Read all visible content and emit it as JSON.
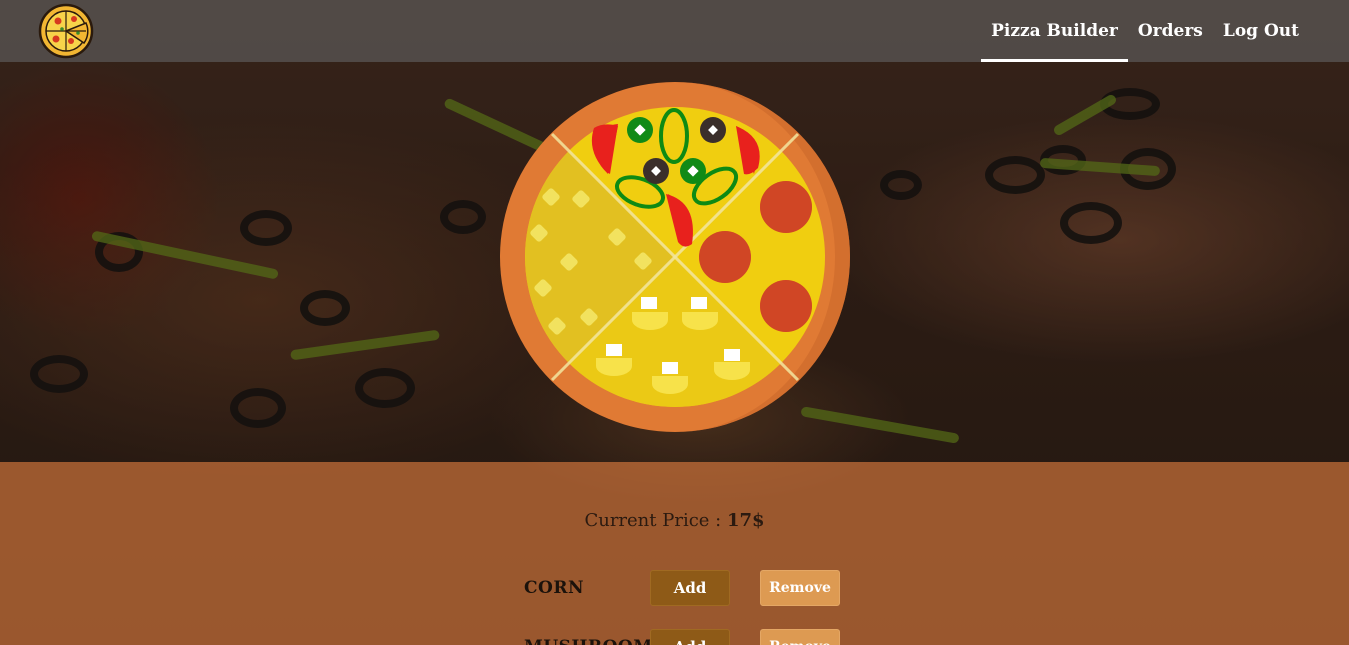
{
  "navbar": {
    "logo_icon": "pizza-logo-icon",
    "links": [
      {
        "label": "Pizza Builder",
        "active": true
      },
      {
        "label": "Orders",
        "active": false
      },
      {
        "label": "Log Out",
        "active": false
      }
    ]
  },
  "builder": {
    "price_label": "Current Price :",
    "price_value": "17$"
  },
  "toppings": [
    {
      "name": "CORN",
      "add_label": "Add",
      "remove_label": "Remove"
    },
    {
      "name": "MUSHROOM",
      "add_label": "Add",
      "remove_label": "Remove"
    }
  ],
  "colors": {
    "nav_bg": "#555555",
    "add_button": "#8e5a17",
    "remove_button": "#dd9a52",
    "controls_bg": "#c46e38",
    "crust": "#e07a34",
    "cheese": "#f0ce10"
  }
}
